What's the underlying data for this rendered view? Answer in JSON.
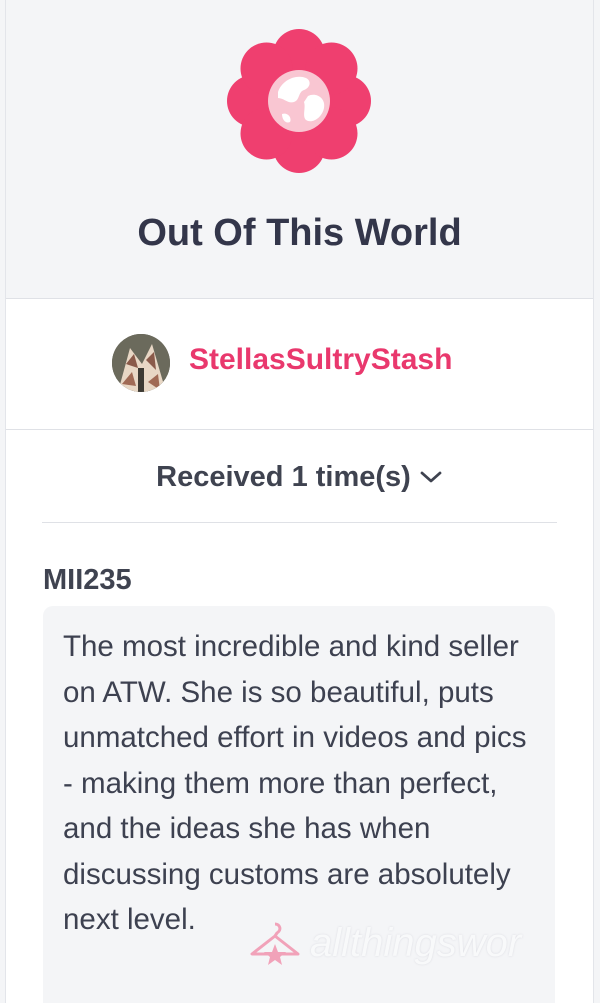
{
  "badge": {
    "title": "Out Of This World",
    "icon": "globe-flower-icon",
    "color": "#ef3f6f"
  },
  "seller": {
    "name": "StellasSultryStash",
    "color": "#e9386d"
  },
  "received": {
    "label": "Received 1 time(s)",
    "icon": "chevron-down-icon"
  },
  "review": {
    "author": "MII235",
    "text": "The most incredible and kind seller on ATW. She is so beautiful, puts unmatched effort in videos and pics - making them more than perfect, and the ideas she has when discussing customs are absolutely next level."
  },
  "watermark": {
    "text": "allthingswor",
    "icon": "hanger-icon"
  }
}
